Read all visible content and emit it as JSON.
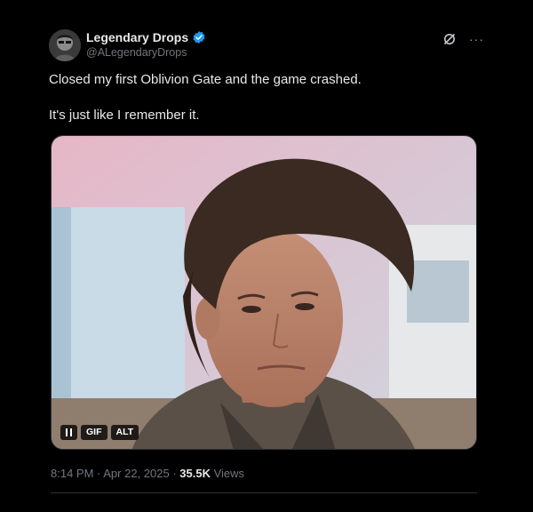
{
  "colors": {
    "background": "#000000",
    "text_primary": "#e7e9ea",
    "text_secondary": "#71767b",
    "verified_badge": "#1d9bf0"
  },
  "author": {
    "display_name": "Legendary Drops",
    "handle": "@ALegendaryDrops",
    "verified_icon": "verified-badge-icon",
    "avatar_icon": "avatar-image"
  },
  "header_actions": {
    "grok_icon": "grok-icon",
    "more_label": "···"
  },
  "tweet": {
    "line1": "Closed my first Oblivion Gate and the game crashed.",
    "line2": "It's just like I remember it."
  },
  "media": {
    "type": "GIF",
    "pause_icon": "pause-icon",
    "gif_label": "GIF",
    "alt_label": "ALT"
  },
  "meta": {
    "time": "8:14 PM",
    "separator1": " · ",
    "date": "Apr 22, 2025",
    "separator2": " · ",
    "views_count": "35.5K",
    "views_label": " Views"
  }
}
